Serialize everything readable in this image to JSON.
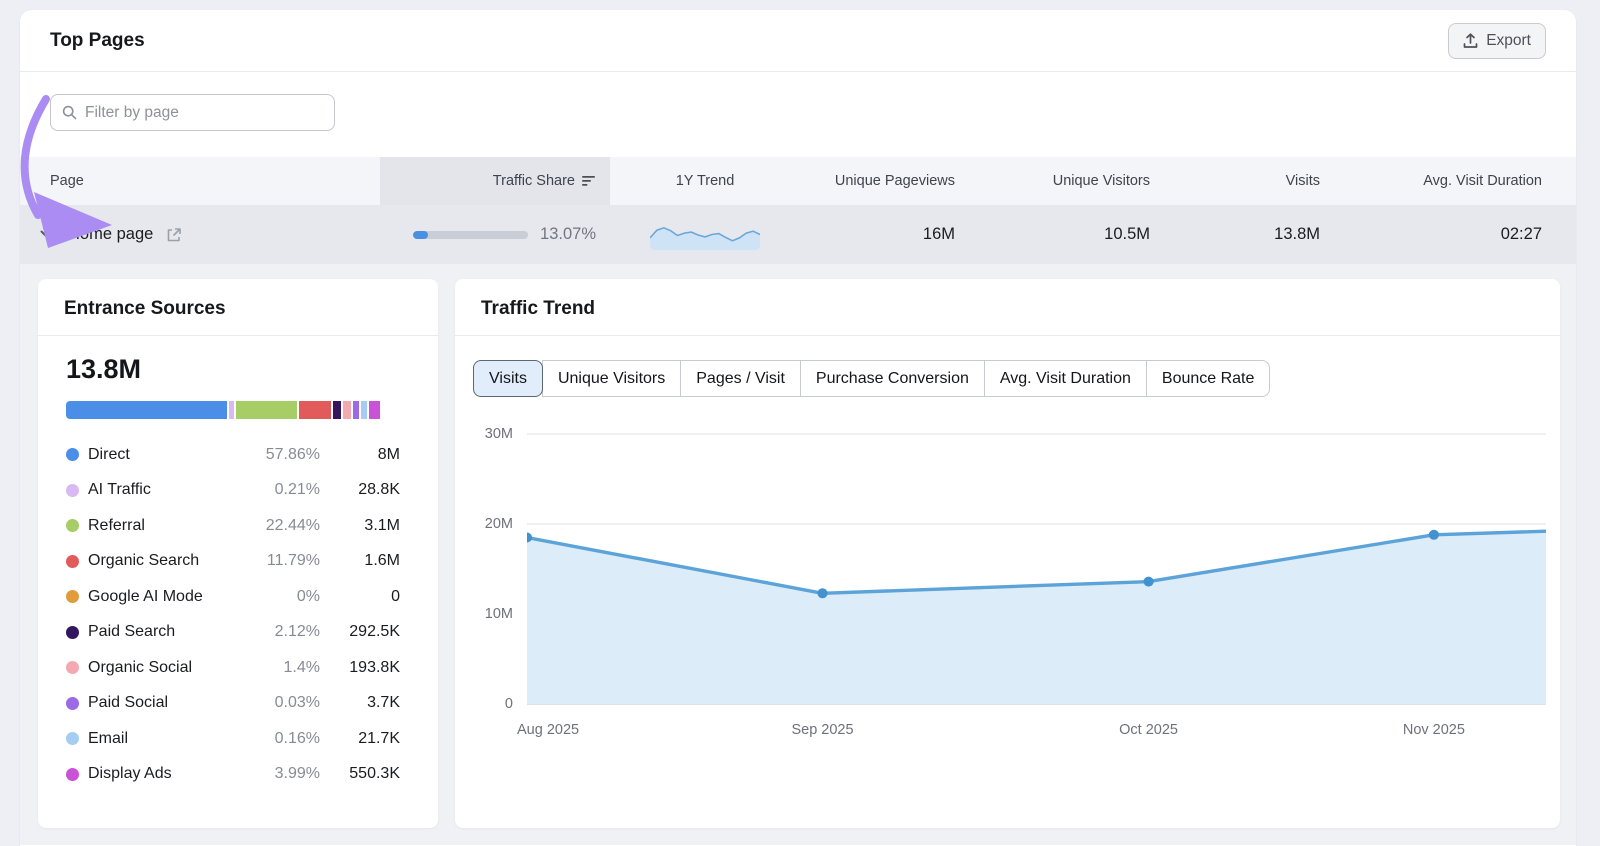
{
  "header": {
    "title": "Top Pages",
    "export_label": "Export"
  },
  "filter": {
    "placeholder": "Filter by page"
  },
  "table": {
    "columns": [
      "Page",
      "Traffic Share",
      "1Y Trend",
      "Unique Pageviews",
      "Unique Visitors",
      "Visits",
      "Avg. Visit Duration"
    ],
    "sorted_column": "Traffic Share",
    "row": {
      "page": "Home page",
      "expanded": true,
      "traffic_share_percent": "13.07%",
      "traffic_share_pct_value": 13.07,
      "unique_pageviews": "16M",
      "unique_visitors": "10.5M",
      "visits": "13.8M",
      "avg_visit_duration": "02:27",
      "sparkline_points": [
        0.62,
        0.3,
        0.2,
        0.32,
        0.52,
        0.42,
        0.38,
        0.5,
        0.58,
        0.48,
        0.44,
        0.6,
        0.74,
        0.62,
        0.42,
        0.34,
        0.48
      ]
    }
  },
  "entrance_sources": {
    "title": "Entrance Sources",
    "total": "13.8M",
    "legend": [
      {
        "label": "Direct",
        "percent": "57.86%",
        "value": "8M",
        "color": "#4a8ee8",
        "bar_share": 48.8
      },
      {
        "label": "AI Traffic",
        "percent": "0.21%",
        "value": "28.8K",
        "color": "#d8b9f2",
        "bar_share": 2.0
      },
      {
        "label": "Referral",
        "percent": "22.44%",
        "value": "3.1M",
        "color": "#a6cd66",
        "bar_share": 19.0
      },
      {
        "label": "Organic Search",
        "percent": "11.79%",
        "value": "1.6M",
        "color": "#e25b5b",
        "bar_share": 10.2
      },
      {
        "label": "Google AI Mode",
        "percent": "0%",
        "value": "0",
        "color": "#e09c3a",
        "bar_share": 0
      },
      {
        "label": "Paid Search",
        "percent": "2.12%",
        "value": "292.5K",
        "color": "#32175f",
        "bar_share": 2.9
      },
      {
        "label": "Organic Social",
        "percent": "1.4%",
        "value": "193.8K",
        "color": "#f4a9b0",
        "bar_share": 2.9
      },
      {
        "label": "Paid Social",
        "percent": "0.03%",
        "value": "3.7K",
        "color": "#9c6ae6",
        "bar_share": 2.6
      },
      {
        "label": "Email",
        "percent": "0.16%",
        "value": "21.7K",
        "color": "#a5cdf2",
        "bar_share": 2.3
      },
      {
        "label": "Display Ads",
        "percent": "3.99%",
        "value": "550.3K",
        "color": "#ca52d6",
        "bar_share": 3.2
      }
    ]
  },
  "traffic_trend": {
    "title": "Traffic Trend",
    "tabs": [
      {
        "label": "Visits",
        "selected": true
      },
      {
        "label": "Unique Visitors",
        "selected": false
      },
      {
        "label": "Pages / Visit",
        "selected": false
      },
      {
        "label": "Purchase Conversion",
        "selected": false
      },
      {
        "label": "Avg. Visit Duration",
        "selected": false
      },
      {
        "label": "Bounce Rate",
        "selected": false
      }
    ]
  },
  "chart_data": {
    "type": "area",
    "title": "Traffic Trend",
    "metric": "Visits",
    "x": [
      "Aug 2025",
      "Sep 2025",
      "Oct 2025",
      "Nov 2025"
    ],
    "values_millions": [
      18.5,
      12.3,
      13.6,
      18.8
    ],
    "trailing_edge_value_millions": 19.2,
    "x_fractions": [
      0,
      0.29,
      0.61,
      0.89
    ],
    "y_ticks": [
      "0",
      "10M",
      "20M",
      "30M"
    ],
    "y_tick_values_millions": [
      0,
      10,
      20,
      30
    ],
    "ylim_millions": [
      0,
      30
    ],
    "grid": "horizontal",
    "legend_position": "none",
    "line_color": "#5ba3d9",
    "fill_color": "#dcecf9",
    "dot_color": "#4292cf"
  },
  "colors": {
    "accent_blue": "#4a90e2",
    "row_bg": "#e6e8ee",
    "header_bg": "#f4f5f8",
    "sorted_header_bg": "#e4e5eb",
    "detail_bg": "#eff1f5",
    "annotation_arrow": "#aa8cf2",
    "selected_tab_bg": "#e1edfb"
  }
}
